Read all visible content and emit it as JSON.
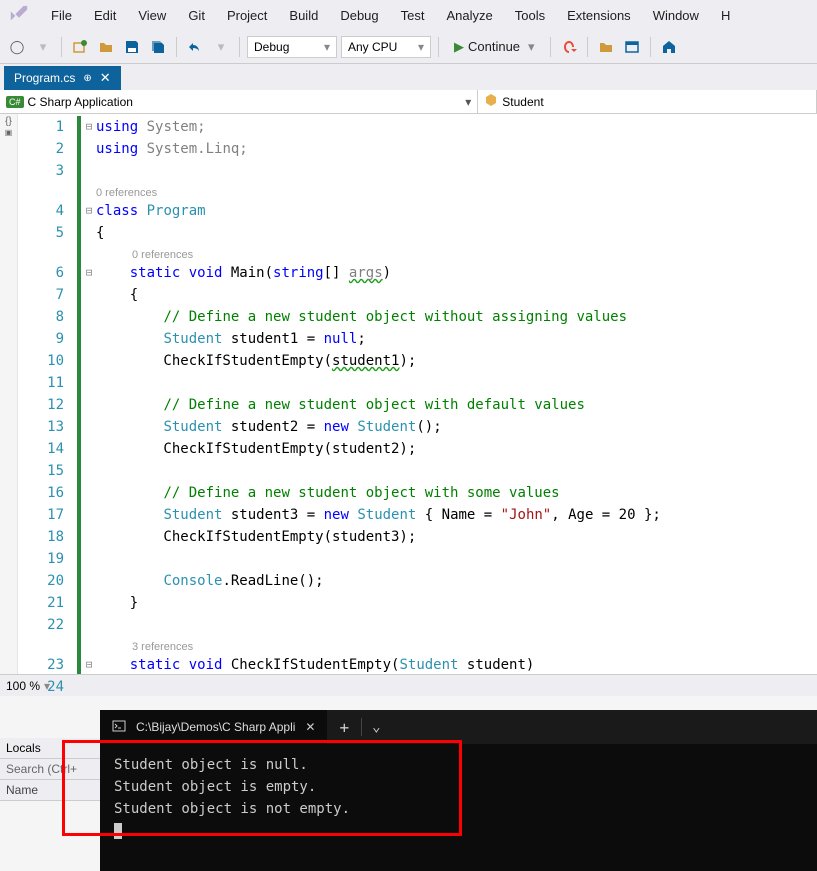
{
  "menu": [
    "File",
    "Edit",
    "View",
    "Git",
    "Project",
    "Build",
    "Debug",
    "Test",
    "Analyze",
    "Tools",
    "Extensions",
    "Window",
    "H"
  ],
  "toolbar": {
    "config": "Debug",
    "platform": "Any CPU",
    "continue": "Continue"
  },
  "tab": {
    "title": "Program.cs"
  },
  "nav": {
    "left": "C Sharp Application",
    "right": "Student"
  },
  "code": {
    "lines": [
      {
        "n": 1,
        "fold": "⊟",
        "html": "<span class='kw'>using</span> <span class='fade'>System;</span>"
      },
      {
        "n": 2,
        "fold": "",
        "html": "<span class='kw'>using</span> <span class='fade'>System.Linq;</span>"
      },
      {
        "n": 3,
        "fold": "",
        "html": ""
      },
      {
        "ref": "0 references",
        "indent": 0
      },
      {
        "n": 4,
        "fold": "⊟",
        "html": "<span class='kw'>class</span> <span class='cls'>Program</span>"
      },
      {
        "n": 5,
        "fold": "",
        "html": "{"
      },
      {
        "ref": "0 references",
        "indent": 36
      },
      {
        "n": 6,
        "fold": "⊟",
        "html": "    <span class='kw'>static</span> <span class='kw'>void</span> Main(<span class='kw'>string</span>[] <span class='fade wavy'>args</span>)"
      },
      {
        "n": 7,
        "fold": "",
        "html": "    {"
      },
      {
        "n": 8,
        "fold": "",
        "html": "        <span class='com'>// Define a new student object without assigning values</span>"
      },
      {
        "n": 9,
        "fold": "",
        "html": "        <span class='cls'>Student</span> student1 = <span class='kw'>null</span>;"
      },
      {
        "n": 10,
        "fold": "",
        "html": "        CheckIfStudentEmpty(<span class='wavy'>student1</span>);"
      },
      {
        "n": 11,
        "fold": "",
        "html": ""
      },
      {
        "n": 12,
        "fold": "",
        "html": "        <span class='com'>// Define a new student object with default values</span>"
      },
      {
        "n": 13,
        "fold": "",
        "html": "        <span class='cls'>Student</span> student2 = <span class='kw'>new</span> <span class='cls'>Student</span>();"
      },
      {
        "n": 14,
        "fold": "",
        "html": "        CheckIfStudentEmpty(student2);"
      },
      {
        "n": 15,
        "fold": "",
        "html": ""
      },
      {
        "n": 16,
        "fold": "",
        "html": "        <span class='com'>// Define a new student object with some values</span>"
      },
      {
        "n": 17,
        "fold": "",
        "html": "        <span class='cls'>Student</span> student3 = <span class='kw'>new</span> <span class='cls'>Student</span> { Name = <span class='str'>\"John\"</span>, Age = 20 };"
      },
      {
        "n": 18,
        "fold": "",
        "html": "        CheckIfStudentEmpty(student3);"
      },
      {
        "n": 19,
        "fold": "",
        "html": ""
      },
      {
        "n": 20,
        "fold": "",
        "html": "        <span class='cls'>Console</span>.ReadLine();"
      },
      {
        "n": 21,
        "fold": "",
        "html": "    }"
      },
      {
        "n": 22,
        "fold": "",
        "html": ""
      },
      {
        "ref": "3 references",
        "indent": 36
      },
      {
        "n": 23,
        "fold": "⊟",
        "html": "    <span class='kw'>static</span> <span class='kw'>void</span> CheckIfStudentEmpty(<span class='cls'>Student</span> student)"
      },
      {
        "n": 24,
        "fold": "",
        "html": "    {",
        "partial": true
      }
    ]
  },
  "zoom": "100 %",
  "locals": {
    "title": "Locals",
    "search": "Search (Ctrl+",
    "col": "Name"
  },
  "terminal": {
    "tab_title": "C:\\Bijay\\Demos\\C Sharp Appli",
    "output": [
      "Student object is null.",
      "Student object is empty.",
      "Student object is not empty."
    ]
  }
}
